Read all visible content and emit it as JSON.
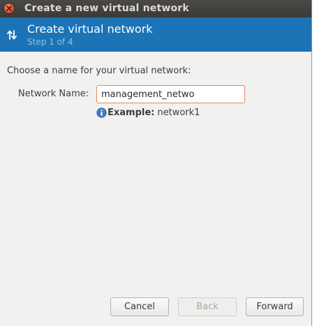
{
  "window": {
    "title": "Create a new virtual network"
  },
  "banner": {
    "title": "Create virtual network",
    "step": "Step 1 of 4",
    "icon": "network-transfer-arrows-icon"
  },
  "form": {
    "prompt": "Choose a name for your virtual network:",
    "network_name_label": "Network Name:",
    "network_name_value": "management_netwo",
    "example_label": "Example:",
    "example_value": "network1"
  },
  "buttons": {
    "cancel": "Cancel",
    "back": "Back",
    "forward": "Forward"
  },
  "colors": {
    "banner": "#1c74b6",
    "titlebar": "#3c3b37",
    "close": "#e2502a",
    "input_focus_border": "#e8895c"
  }
}
